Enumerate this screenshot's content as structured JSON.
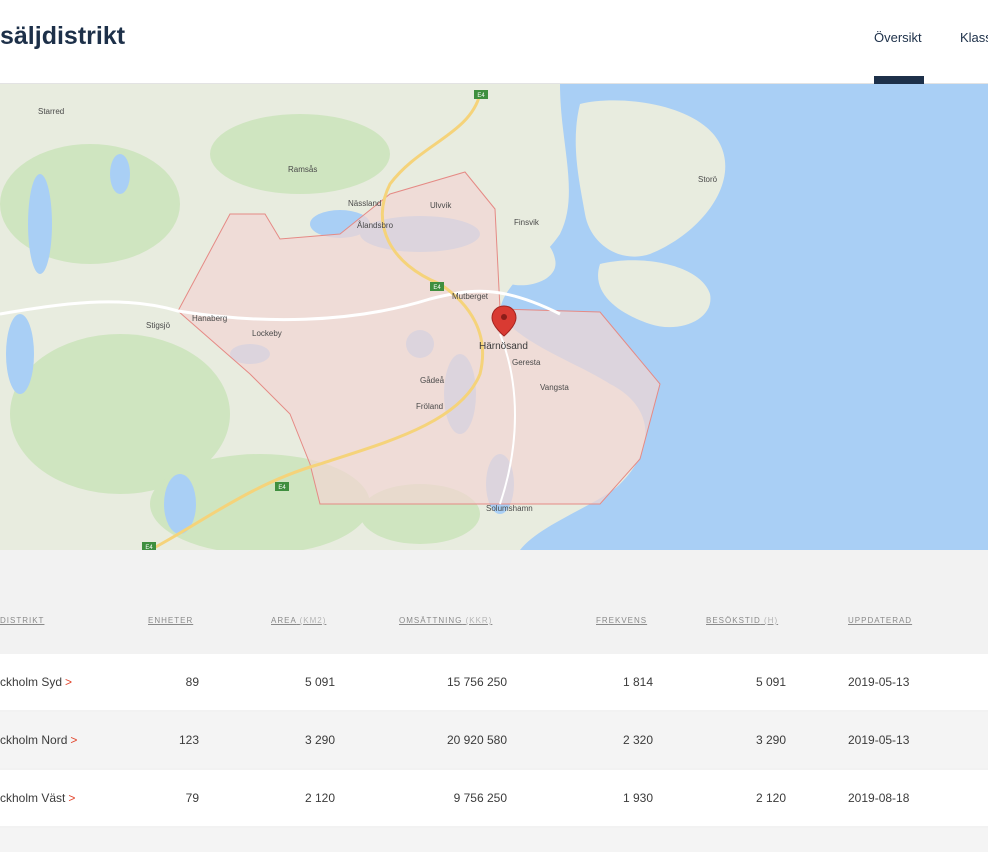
{
  "header": {
    "title": "säljdistrikt",
    "nav": [
      {
        "label": "Översikt",
        "active": true
      },
      {
        "label": "Klass"
      }
    ]
  },
  "map": {
    "places": {
      "starred": "Starred",
      "ramsas": "Ramsås",
      "nassland": "Nässland",
      "ulvvik": "Ulvvik",
      "alandsbro": "Ålandsbro",
      "finsvik": "Finsvik",
      "storo": "Storö",
      "mutberget": "Mutberget",
      "hanaberg": "Hanaberg",
      "stigsjo": "Stigsjö",
      "lockeby": "Lockeby",
      "harnosand": "Härnösand",
      "geresta": "Geresta",
      "vangsta": "Vangsta",
      "gadea": "Gådeå",
      "froland": "Fröland",
      "solumshamn": "Solumshamn"
    },
    "road_shield": "E4",
    "colors": {
      "water": "#a9cff5",
      "land": "#e8ecdf",
      "forest": "#cfe5c0",
      "district": "#f2d6d3",
      "district_stroke": "#e58a85",
      "pin": "#d93a32"
    }
  },
  "table": {
    "columns": {
      "distrikt": "DISTRIKT",
      "enheter": "ENHETER",
      "area": "AREA",
      "area_unit": "(KM2)",
      "omsattning": "OMSÄTTNING",
      "omsattning_unit": "(KKR)",
      "frekvens": "FREKVENS",
      "besokstid": "BESÖKSTID",
      "besokstid_unit": "(H)",
      "uppdaterad": "UPPDATERAD"
    },
    "rows": [
      {
        "name": "Stockholm Syd",
        "enheter": "89",
        "area": "5 091",
        "omsattning": "15 756 250",
        "frekvens": "1 814",
        "besokstid": "5 091",
        "uppdaterad": "2019-05-13"
      },
      {
        "name": "Stockholm Nord",
        "enheter": "123",
        "area": "3 290",
        "omsattning": "20 920 580",
        "frekvens": "2 320",
        "besokstid": "3 290",
        "uppdaterad": "2019-05-13"
      },
      {
        "name": "Stockholm Väst",
        "enheter": "79",
        "area": "2 120",
        "omsattning": "9 756 250",
        "frekvens": "1 930",
        "besokstid": "2 120",
        "uppdaterad": "2019-08-18"
      }
    ],
    "chevron": ">"
  }
}
